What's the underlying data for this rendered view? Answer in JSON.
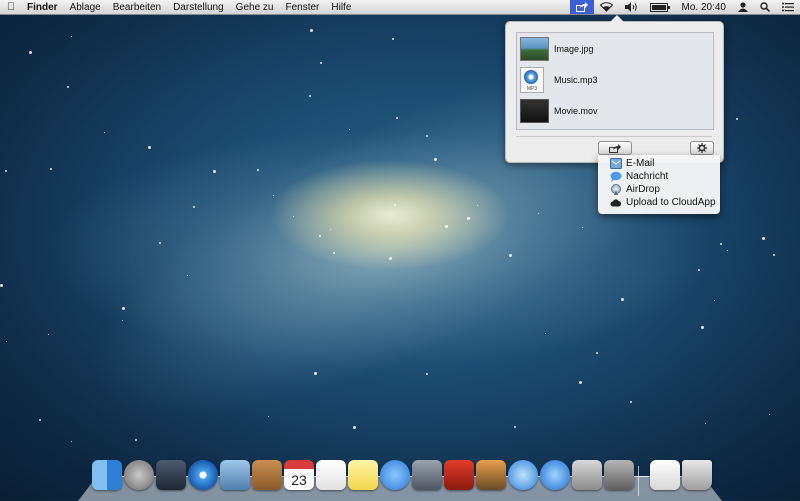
{
  "menubar": {
    "app_name": "Finder",
    "menus": [
      "Ablage",
      "Bearbeiten",
      "Darstellung",
      "Gehe zu",
      "Fenster",
      "Hilfe"
    ],
    "clock": "Mo. 20:40"
  },
  "popover": {
    "files": [
      {
        "name": "Image.jpg",
        "icon": "image-thumbnail"
      },
      {
        "name": "Music.mp3",
        "icon": "mp3-file-icon",
        "icon_label": "MP3"
      },
      {
        "name": "Movie.mov",
        "icon": "movie-thumbnail"
      }
    ]
  },
  "share_menu": {
    "items": [
      {
        "label": "E-Mail",
        "icon": "mail-icon"
      },
      {
        "label": "Nachricht",
        "icon": "messages-icon"
      },
      {
        "label": "AirDrop",
        "icon": "airdrop-icon"
      },
      {
        "label": "Upload to CloudApp",
        "icon": "cloud-icon"
      }
    ]
  },
  "dock": {
    "calendar_day": "23",
    "apps": [
      "finder-icon",
      "launchpad-icon",
      "mission-control-icon",
      "safari-icon",
      "mail-app-icon",
      "contacts-icon",
      "calendar-icon",
      "reminders-icon",
      "notes-icon",
      "messages-app-icon",
      "facetime-icon",
      "photo-booth-icon",
      "iphoto-icon",
      "itunes-icon",
      "app-store-icon",
      "preview-icon",
      "system-preferences-icon",
      "documents-stack-icon",
      "trash-icon"
    ]
  },
  "colors": {
    "menubar_highlight": "#3d5fd6",
    "desktop_dark": "#0f2c48"
  }
}
